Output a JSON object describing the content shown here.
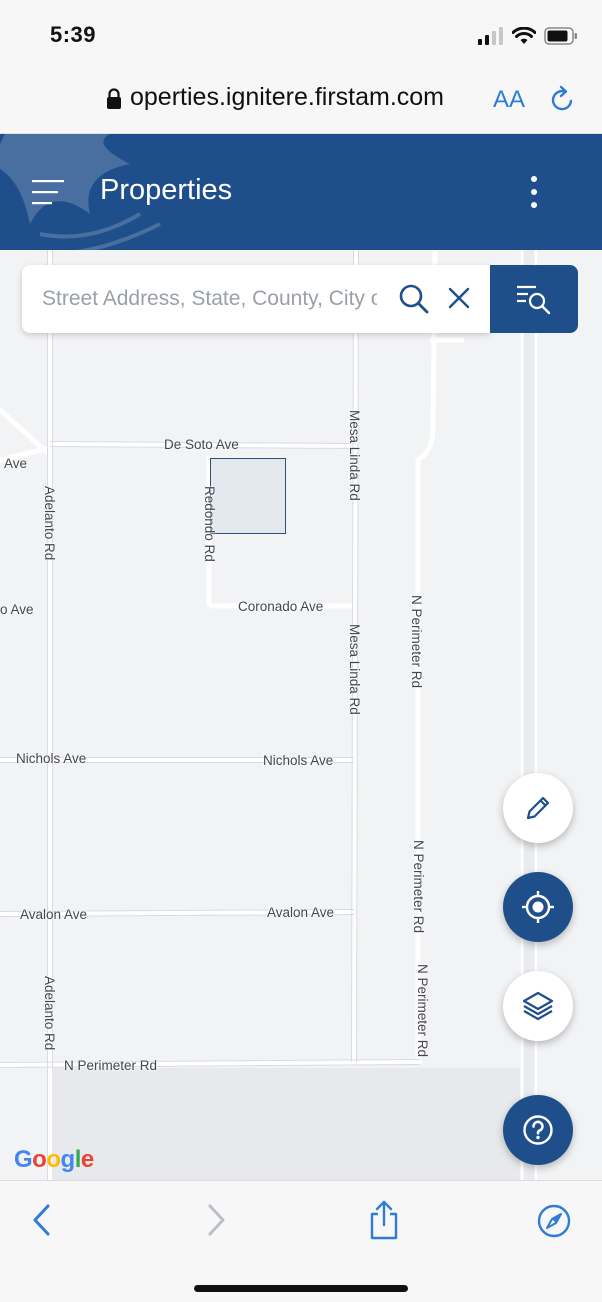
{
  "status_bar": {
    "time": "5:39"
  },
  "browser": {
    "url": "operties.ignitere.firstam.com",
    "text_size_button": "AA"
  },
  "header": {
    "title": "Properties",
    "color": "#1f4f8b"
  },
  "search": {
    "placeholder": "Street Address, State, County, City or APN",
    "value": ""
  },
  "map": {
    "labels": {
      "de_soto_ave": "De Soto Ave",
      "ave_left": "Ave",
      "adelanto_rd_top": "Adelanto Rd",
      "redondo_rd": "Redondo Rd",
      "mesa_linda_rd_top": "Mesa Linda Rd",
      "coronado_ave": "Coronado Ave",
      "o_ave": "o Ave",
      "n_perimeter_rd_top": "N Perimeter Rd",
      "mesa_linda_rd_mid": "Mesa Linda Rd",
      "nichols_ave_left": "Nichols Ave",
      "nichols_ave_right": "Nichols Ave",
      "n_perimeter_rd_mid": "N Perimeter Rd",
      "avalon_ave_left": "Avalon Ave",
      "avalon_ave_right": "Avalon Ave",
      "n_perimeter_rd_low": "N Perimeter Rd",
      "adelanto_rd_bottom": "Adelanto Rd",
      "n_perimeter_rd_horizontal": "N Perimeter Rd"
    },
    "attribution": "Google"
  },
  "icons": {
    "menu": "hamburger-icon",
    "more": "kebab-icon",
    "search": "search-icon",
    "clear": "close-icon",
    "results": "list-search-icon",
    "draw": "pencil-icon",
    "locate": "crosshair-icon",
    "layers": "layers-icon",
    "help": "question-icon",
    "back": "chevron-left-icon",
    "forward": "chevron-right-icon",
    "share": "share-icon",
    "compass": "compass-icon"
  },
  "colors": {
    "accent": "#1f4f8b",
    "safari_blue": "#2f7bd6",
    "map_bg": "#f2f3f5",
    "parcel_fill": "#e3e8ee"
  }
}
